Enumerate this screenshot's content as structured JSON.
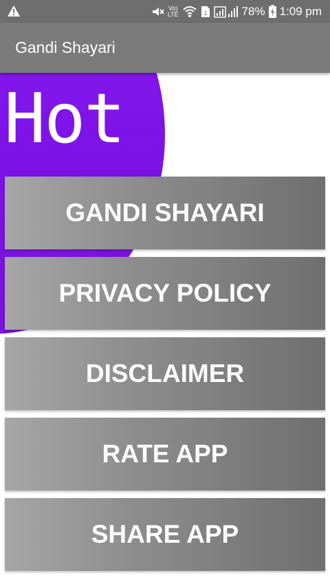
{
  "status_bar": {
    "time": "1:09 pm",
    "battery": "78%",
    "network_label": "LTE",
    "icons": [
      "warning-icon",
      "mute-icon",
      "volte-icon",
      "wifi-icon",
      "sim-icon",
      "signal-icon",
      "battery-charging-icon"
    ]
  },
  "app_bar": {
    "title": "Gandi Shayari"
  },
  "banner": {
    "text": "Hot",
    "color": "#8a1ff0"
  },
  "menu": {
    "items": [
      {
        "label": "GANDI SHAYARI"
      },
      {
        "label": "PRIVACY POLICY"
      },
      {
        "label": "DISCLAIMER"
      },
      {
        "label": "RATE APP"
      },
      {
        "label": "SHARE APP"
      }
    ]
  },
  "colors": {
    "status_bar": "#6e6e6e",
    "app_bar": "#7b7b7b",
    "button_light": "#a6a6a6",
    "button_dark": "#6f6f6f"
  }
}
